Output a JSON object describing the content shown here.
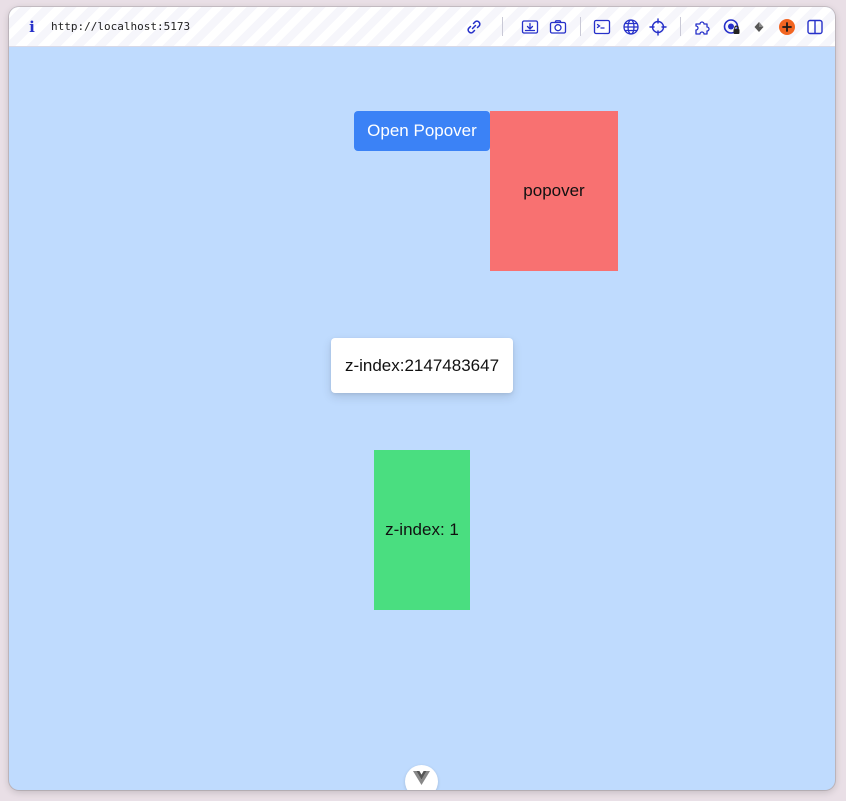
{
  "browser": {
    "url": "http://localhost:5173",
    "toolbar_icons": [
      "link-icon",
      "download-icon",
      "camera-icon",
      "terminal-icon",
      "globe-icon",
      "crosshair-icon",
      "extensions-puzzle-icon",
      "password-manager-icon",
      "diamond-extension-icon",
      "plus-extension-icon",
      "sidebar-toggle-icon"
    ]
  },
  "page": {
    "button_label": "Open Popover",
    "popover_text": "popover",
    "zindex_max_text": "z-index:2147483647",
    "zindex_one_text": "z-index: 1"
  },
  "colors": {
    "page_background": "#bfdbfe",
    "button": "#3b82f6",
    "popover": "#f87171",
    "zindex_one_box": "#4ade80",
    "icon_accent": "#2630c9"
  }
}
